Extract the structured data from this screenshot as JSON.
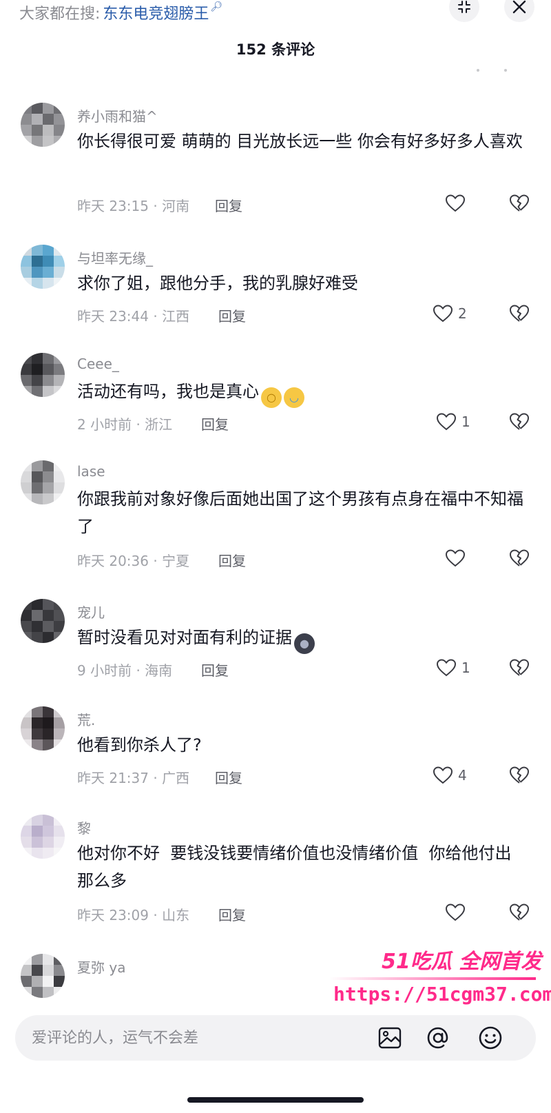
{
  "header": {
    "search_prefix": "大家都在搜:",
    "search_keyword": "东东电竞翅膀王",
    "comments_count": "152 条评论"
  },
  "icons": {
    "collapse": "collapse-icon",
    "close": "close-icon",
    "like": "heart-outline-icon",
    "dislike": "broken-heart-icon",
    "image": "image-icon",
    "mention": "at-mention-icon",
    "emoji": "smiley-icon"
  },
  "comments": [
    {
      "username": "养小雨和猫^",
      "content": "你长得很可爱 萌萌的 目光放长远一些 你会有好多好多人喜欢",
      "time": "昨天 23:15 · 河南",
      "reply": "回复",
      "likes": ""
    },
    {
      "username": "与坦率无缘_",
      "content": "求你了姐，跟他分手，我的乳腺好难受",
      "time": "昨天 23:44 · 江西",
      "reply": "回复",
      "likes": "2"
    },
    {
      "username": "Ceee_",
      "content": "活动还有吗，我也是真心",
      "time": "2 小时前 · 浙江",
      "reply": "回复",
      "likes": "1"
    },
    {
      "username": "lase",
      "content": "你跟我前对象好像后面她出国了这个男孩有点身在福中不知福了",
      "time": "昨天 20:36 · 宁夏",
      "reply": "回复",
      "likes": ""
    },
    {
      "username": "宠儿",
      "content": "暂时没看见对对面有利的证据",
      "time": "9 小时前 · 海南",
      "reply": "回复",
      "likes": "1"
    },
    {
      "username": "荒.",
      "content": "他看到你杀人了?",
      "time": "昨天 21:37 · 广西",
      "reply": "回复",
      "likes": "4"
    },
    {
      "username": "黎",
      "content": "他对你不好  要钱没钱要情绪价值也没情绪价值  你给他付出那么多",
      "time": "昨天 23:09 · 山东",
      "reply": "回复",
      "likes": ""
    },
    {
      "username": "夏弥 ya",
      "content": "",
      "time": "",
      "reply": "",
      "likes": ""
    }
  ],
  "watermark": {
    "title": "51吃瓜 全网首发",
    "url": "https://51cgm37.com"
  },
  "input": {
    "placeholder": "爱评论的人，运气不会差"
  },
  "colors": {
    "keyword": "#2a5caa",
    "watermark": "#ff2a8a",
    "text_primary": "#161823",
    "text_secondary": "#8a8b91"
  }
}
